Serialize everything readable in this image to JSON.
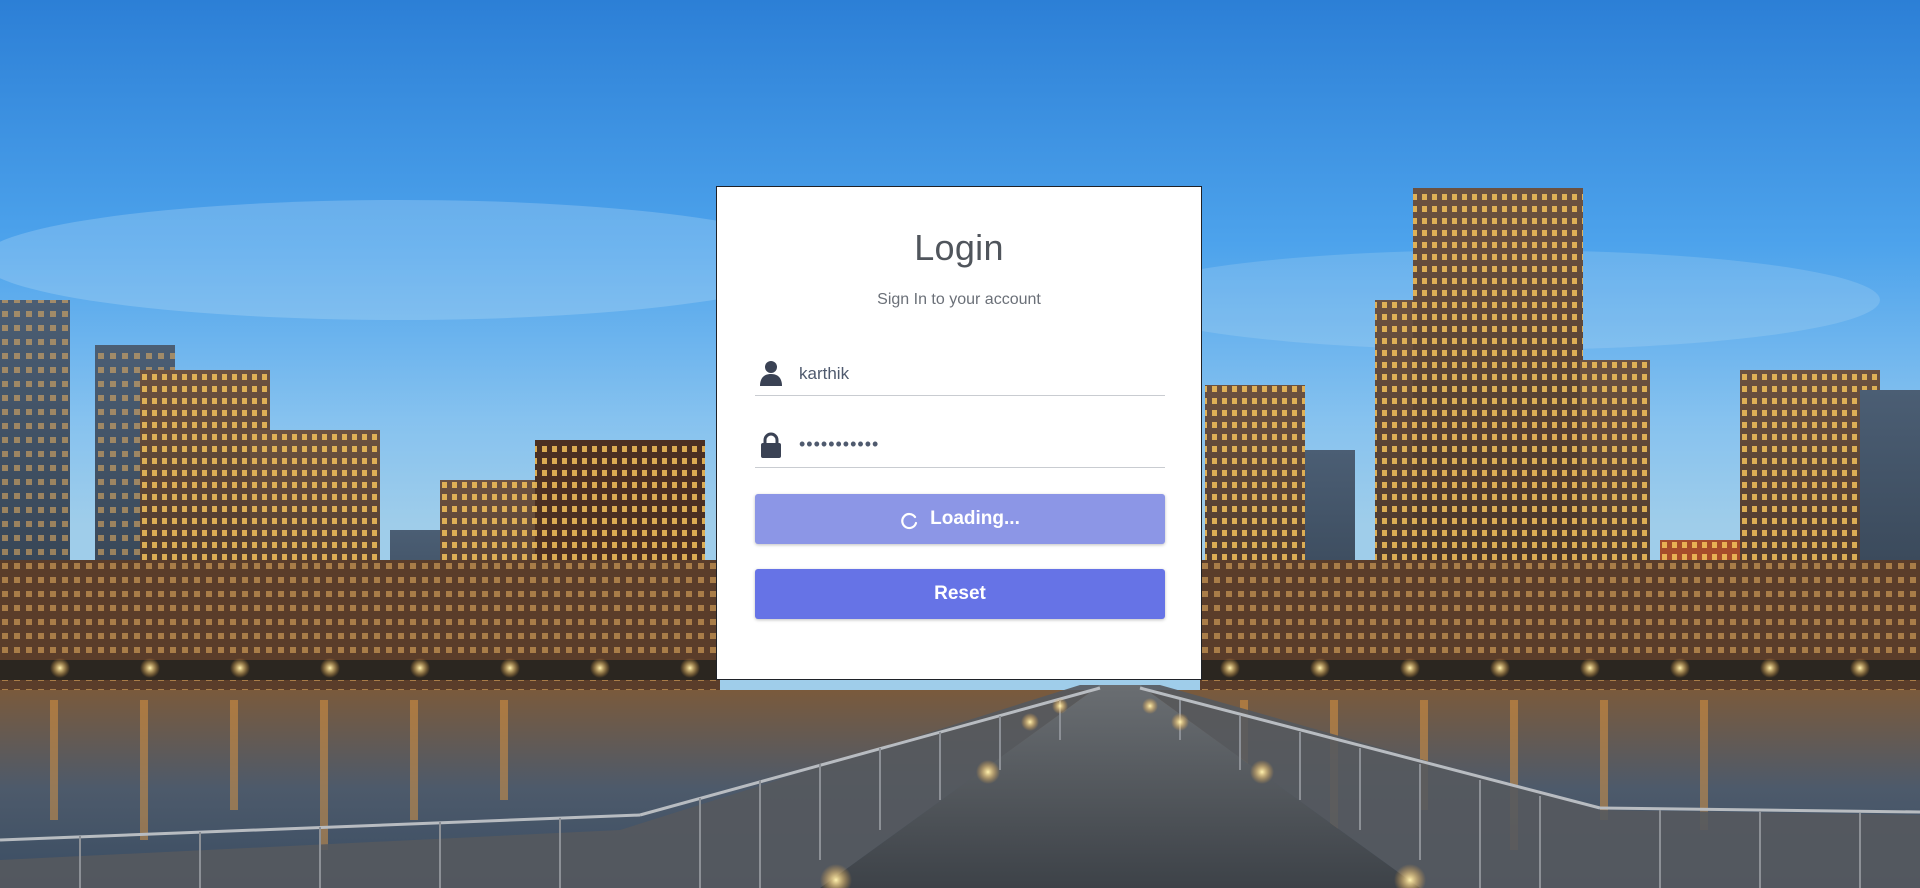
{
  "login": {
    "title": "Login",
    "subtitle": "Sign In to your account",
    "username_value": "karthik",
    "password_value": "•••••••••••",
    "loading_label": "Loading...",
    "reset_label": "Reset"
  },
  "colors": {
    "primary_button": "#6673e6",
    "loading_button": "#8c96e6",
    "title_text": "#50555c",
    "icon": "#3a4254"
  },
  "icons": {
    "username": "user-icon",
    "password": "lock-icon",
    "loading": "spinner-icon"
  }
}
